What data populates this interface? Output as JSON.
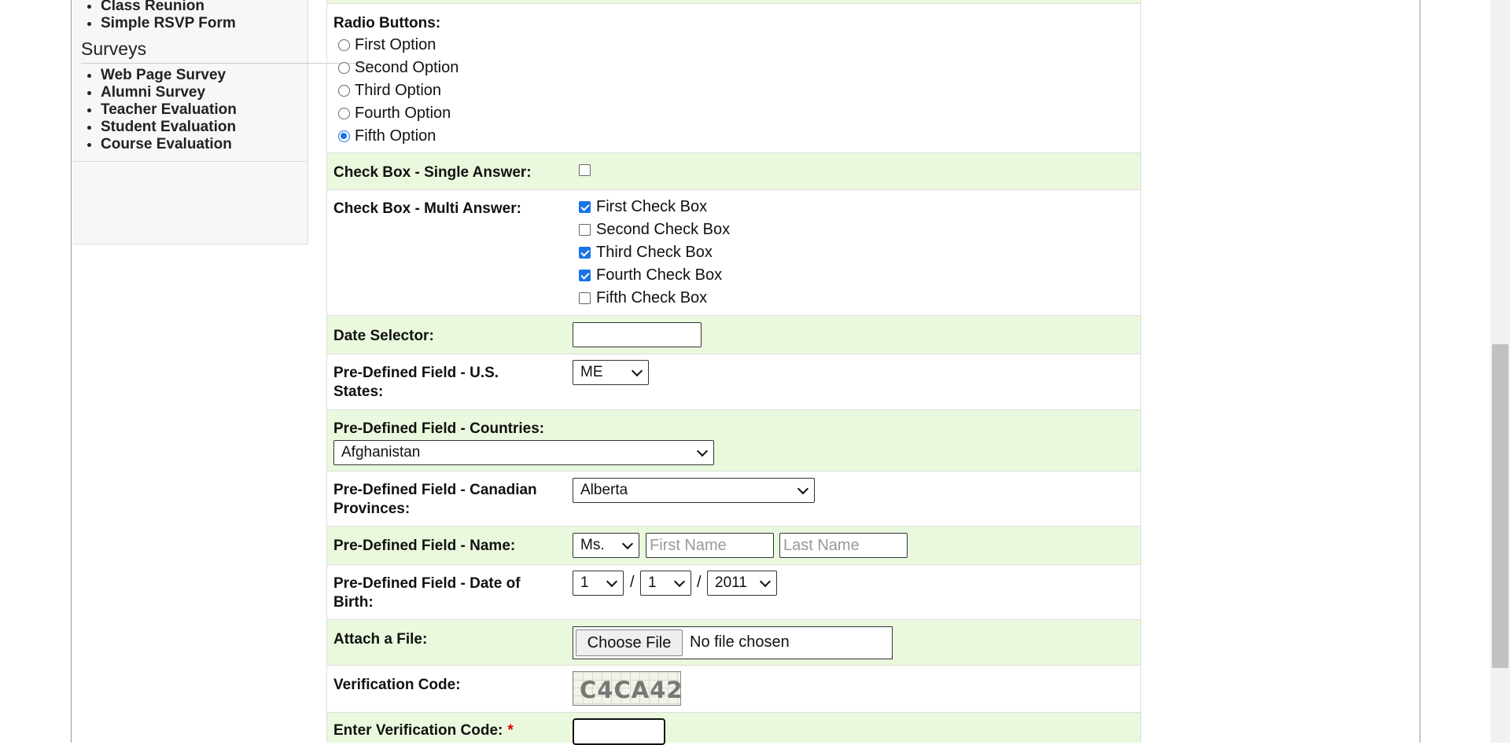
{
  "sidebar": {
    "forms_items": [
      "Class Reunion",
      "Simple RSVP Form"
    ],
    "surveys_title": "Surveys",
    "surveys_items": [
      "Web Page Survey",
      "Alumni Survey",
      "Teacher Evaluation",
      "Student Evaluation",
      "Course Evaluation"
    ]
  },
  "form": {
    "radio": {
      "label": "Radio Buttons:",
      "options": [
        "First Option",
        "Second Option",
        "Third Option",
        "Fourth Option",
        "Fifth Option"
      ],
      "selected": "Fifth Option"
    },
    "checkbox_single": {
      "label": "Check Box - Single Answer:",
      "checked": false
    },
    "checkbox_multi": {
      "label": "Check Box - Multi Answer:",
      "options": [
        "First Check Box",
        "Second Check Box",
        "Third Check Box",
        "Fourth Check Box",
        "Fifth Check Box"
      ],
      "checked": [
        true,
        false,
        true,
        true,
        false
      ]
    },
    "date_selector": {
      "label": "Date Selector:",
      "value": ""
    },
    "us_states": {
      "label_line1": "Pre-Defined Field - U.S.",
      "label_line2": "States:",
      "value": "ME"
    },
    "countries": {
      "label": "Pre-Defined Field - Countries:",
      "value": "Afghanistan"
    },
    "canadian_provinces": {
      "label_line1": "Pre-Defined Field - Canadian",
      "label_line2": "Provinces:",
      "value": "Alberta"
    },
    "name": {
      "label": "Pre-Defined Field - Name:",
      "title_value": "Ms.",
      "first_placeholder": "First Name",
      "last_placeholder": "Last Name"
    },
    "date_of_birth": {
      "label_line1": "Pre-Defined Field - Date of",
      "label_line2": "Birth:",
      "month": "1",
      "day": "1",
      "year": "2011",
      "separator": "/"
    },
    "attach_file": {
      "label": "Attach a File:",
      "button": "Choose File",
      "status": "No file chosen"
    },
    "verification": {
      "label": "Verification Code:",
      "code": "C4CA42"
    },
    "enter_verification": {
      "label": "Enter Verification Code:",
      "required_mark": "*",
      "value": ""
    }
  },
  "colors": {
    "row_green": "#eaf9dd",
    "accent_blue": "#1a73e8",
    "required_red": "#dd0000"
  }
}
